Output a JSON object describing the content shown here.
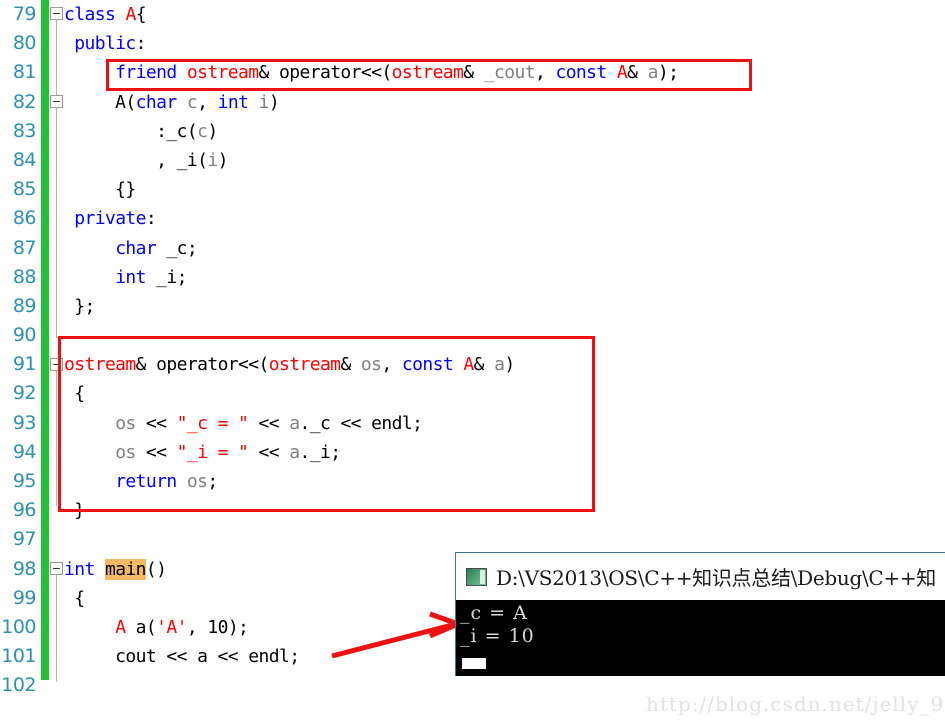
{
  "editor": {
    "first_line_number": 79,
    "lines": [
      {
        "num": 79,
        "indent": 0,
        "changed": true,
        "fold": "open"
      },
      {
        "num": 80,
        "indent": 0,
        "changed": true,
        "fold": null
      },
      {
        "num": 81,
        "indent": 0,
        "changed": true,
        "fold": null
      },
      {
        "num": 82,
        "indent": 0,
        "changed": true,
        "fold": "open"
      },
      {
        "num": 83,
        "indent": 0,
        "changed": true,
        "fold": null
      },
      {
        "num": 84,
        "indent": 0,
        "changed": true,
        "fold": null
      },
      {
        "num": 85,
        "indent": 0,
        "changed": true,
        "fold": null
      },
      {
        "num": 86,
        "indent": 0,
        "changed": true,
        "fold": null
      },
      {
        "num": 87,
        "indent": 0,
        "changed": true,
        "fold": null
      },
      {
        "num": 88,
        "indent": 0,
        "changed": true,
        "fold": null
      },
      {
        "num": 89,
        "indent": 0,
        "changed": true,
        "fold": null
      },
      {
        "num": 90,
        "indent": 0,
        "changed": true,
        "fold": null
      },
      {
        "num": 91,
        "indent": 0,
        "changed": true,
        "fold": "open"
      },
      {
        "num": 92,
        "indent": 0,
        "changed": true,
        "fold": null
      },
      {
        "num": 93,
        "indent": 0,
        "changed": true,
        "fold": null
      },
      {
        "num": 94,
        "indent": 0,
        "changed": true,
        "fold": null
      },
      {
        "num": 95,
        "indent": 0,
        "changed": true,
        "fold": null
      },
      {
        "num": 96,
        "indent": 0,
        "changed": true,
        "fold": null
      },
      {
        "num": 97,
        "indent": 0,
        "changed": true,
        "fold": null
      },
      {
        "num": 98,
        "indent": 0,
        "changed": true,
        "fold": "open"
      },
      {
        "num": 99,
        "indent": 0,
        "changed": true,
        "fold": null
      },
      {
        "num": 100,
        "indent": 0,
        "changed": true,
        "fold": null
      },
      {
        "num": 101,
        "indent": 0,
        "changed": true,
        "fold": null
      },
      {
        "num": 102,
        "indent": 0,
        "changed": true,
        "fold": null
      }
    ],
    "line_numbers": [
      "79",
      "80",
      "81",
      "82",
      "83",
      "84",
      "85",
      "86",
      "87",
      "88",
      "89",
      "90",
      "91",
      "92",
      "93",
      "94",
      "95",
      "96",
      "97",
      "98",
      "99",
      "100",
      "101",
      "102"
    ],
    "code_text": [
      "class A{",
      "public:",
      "    friend ostream& operator<<(ostream& _cout, const A& a);",
      "    A(char c, int i)",
      "        :_c(c)",
      "        , _i(i)",
      "    {}",
      "private:",
      "    char _c;",
      "    int _i;",
      "};",
      "",
      "ostream& operator<<(ostream& os, const A& a)",
      "{",
      "    os << \"_c = \" << a._c << endl;",
      "    os << \"_i = \" << a._i;",
      "    return os;",
      "}",
      "",
      "int main()",
      "{",
      "    A a('A', 10);",
      "    cout << a << endl;",
      ""
    ],
    "highlighted_token": "main",
    "colors": {
      "keyword": "#0000ff",
      "type": "#ff0000",
      "identifier": "#808080",
      "string": "#ff0000",
      "linenumber": "#2b91af",
      "changebar": "#24c13a",
      "highlight_bg": "#f5b964",
      "annotation": "#ee1111",
      "text": "#000000"
    }
  },
  "annotations": {
    "box1_label": "friend-declaration-highlight",
    "box2_label": "operator-overload-definition-highlight",
    "arrow_label": "points-to-console-output"
  },
  "console": {
    "icon": "console-window-icon",
    "title": "D:\\VS2013\\OS\\C++知识点总结\\Debug\\C++知",
    "output_lines": [
      "_c = A",
      "_i = 10"
    ]
  },
  "watermark": {
    "text": "http://blog.csdn.net/jelly_9"
  }
}
